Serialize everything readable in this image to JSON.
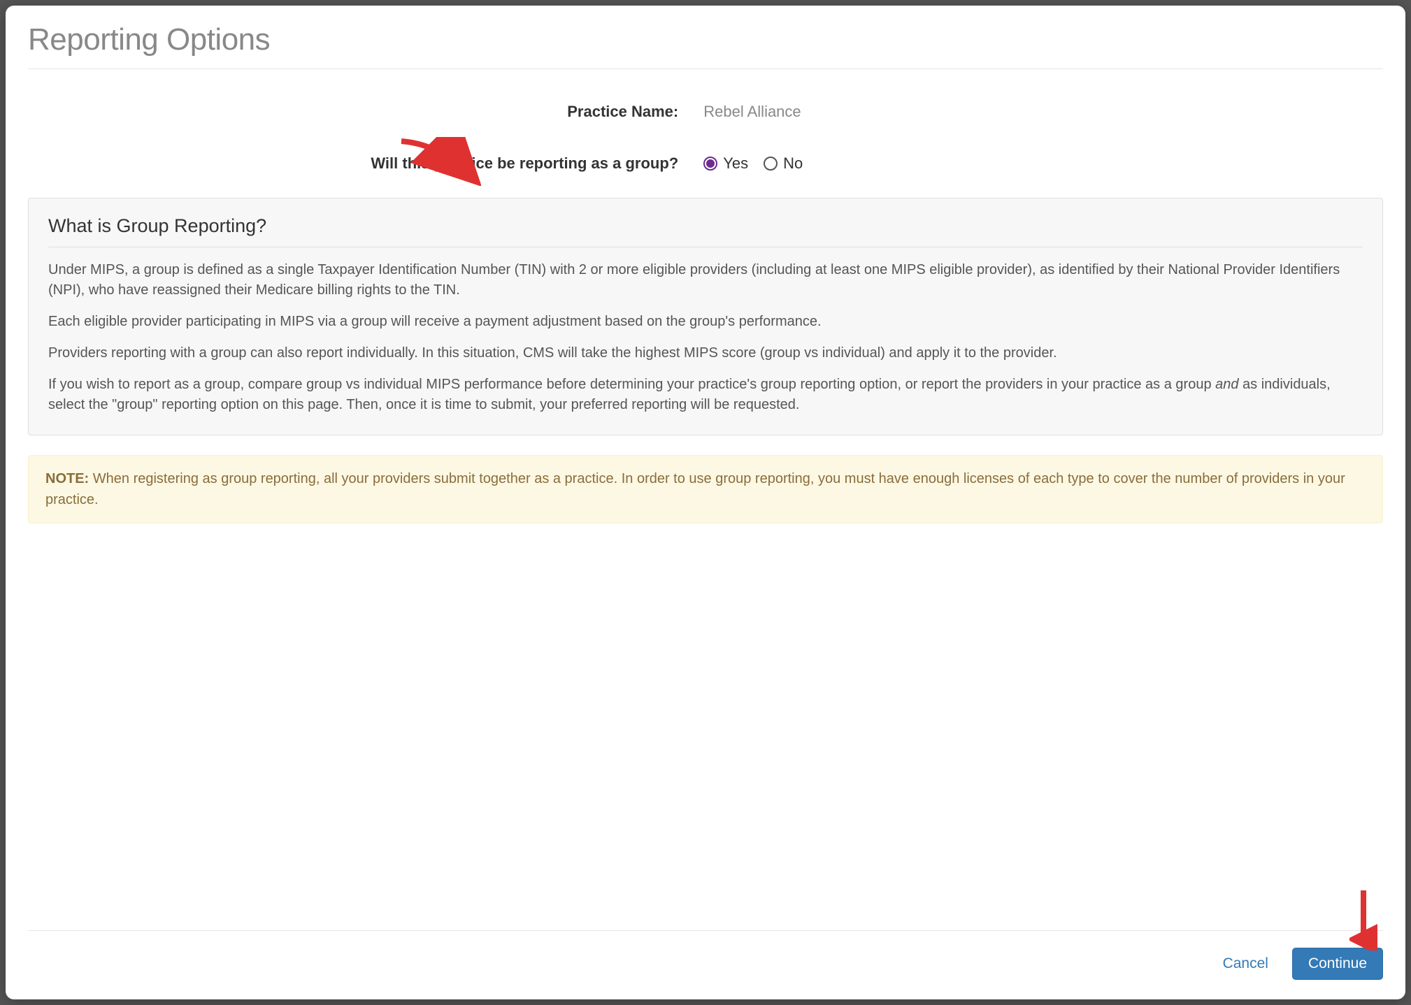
{
  "title": "Reporting Options",
  "practice": {
    "label": "Practice Name:",
    "value": "Rebel Alliance"
  },
  "question": {
    "label": "Will this practice be reporting as a group?",
    "options": {
      "yes": "Yes",
      "no": "No"
    },
    "selected": "yes"
  },
  "info": {
    "heading": "What is Group Reporting?",
    "p1": "Under MIPS, a group is defined as a single Taxpayer Identification Number (TIN) with 2 or more eligible providers (including at least one MIPS eligible provider), as identified by their National Provider Identifiers (NPI), who have reassigned their Medicare billing rights to the TIN.",
    "p2": "Each eligible provider participating in MIPS via a group will receive a payment adjustment based on the group's performance.",
    "p3": "Providers reporting with a group can also report individually. In this situation, CMS will take the highest MIPS score (group vs individual) and apply it to the provider.",
    "p4_a": "If you wish to report as a group, compare group vs individual MIPS performance before determining your practice's group reporting option, or report the providers in your practice as a group ",
    "p4_em": "and",
    "p4_b": " as individuals, select the \"group\" reporting option on this page. Then, once it is time to submit, your preferred reporting will be requested."
  },
  "note": {
    "prefix": "NOTE:",
    "text": " When registering as group reporting, all your providers submit together as a practice. In order to use group reporting, you must have enough licenses of each type to cover the number of providers in your practice."
  },
  "buttons": {
    "cancel": "Cancel",
    "continue": "Continue"
  }
}
